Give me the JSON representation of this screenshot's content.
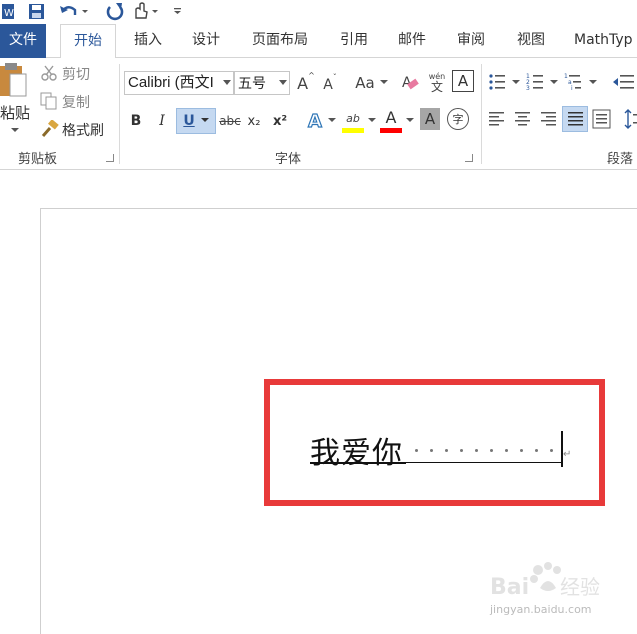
{
  "tabs": [
    "文件",
    "开始",
    "插入",
    "设计",
    "页面布局",
    "引用",
    "邮件",
    "审阅",
    "视图",
    "MathTyp"
  ],
  "clipboard": {
    "paste_label": "粘贴",
    "cut_label": "剪切",
    "copy_label": "复制",
    "format_painter_label": "格式刷",
    "group_label": "剪贴板"
  },
  "font": {
    "font_name": "Calibri (西文I",
    "font_size": "五号",
    "group_label": "字体",
    "bold": "B",
    "italic": "I",
    "underline": "U",
    "strikethrough": "abc",
    "subscript": "x₂",
    "superscript": "x²",
    "change_case": "Aa",
    "phonetic_top": "wén",
    "phonetic_bottom": "文",
    "char_border": "A",
    "grow": "A",
    "shrink": "A",
    "text_effect": "A",
    "highlight": "ab",
    "font_color": "A",
    "char_shading": "A",
    "enclose": "字"
  },
  "paragraph": {
    "group_label": "段落"
  },
  "document": {
    "text": "我爱你"
  },
  "watermark": {
    "url": "jingyan.baidu.com"
  },
  "colors": {
    "file_tab": "#2b579a",
    "highlight_yellow": "#ffff00",
    "font_red": "#ff0000",
    "box_red": "#e83a3a"
  }
}
